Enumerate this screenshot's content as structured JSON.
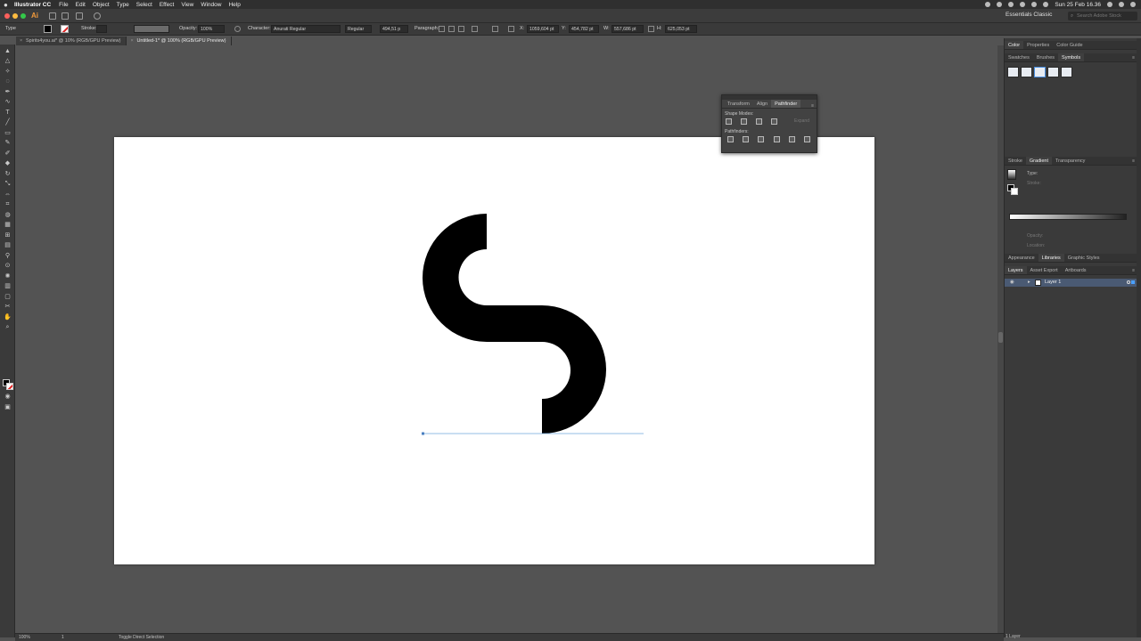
{
  "menubar": {
    "app_name": "Illustrator CC",
    "items": [
      "File",
      "Edit",
      "Object",
      "Type",
      "Select",
      "Effect",
      "View",
      "Window",
      "Help"
    ],
    "datetime": "Sun 25 Feb 16.36"
  },
  "appbar": {
    "logo": "Ai",
    "workspace": "Essentials Classic",
    "search_placeholder": "Search Adobe Stock"
  },
  "controlbar": {
    "tool_label": "Type",
    "stroke_label": "Stroke:",
    "opacity_label": "Opacity:",
    "opacity_value": "100%",
    "character_label": "Character:",
    "font_family": "Anurati Regular",
    "font_style": "Regular",
    "font_size": "494,51 p",
    "paragraph_label": "Paragraph:",
    "x_label": "X:",
    "x_value": "1059,604 pt",
    "y_label": "Y:",
    "y_value": "454,782 pt",
    "w_label": "W:",
    "w_value": "557,686 pt",
    "h_label": "H:",
    "h_value": "625,053 pt"
  },
  "doc_tabs": [
    {
      "title": "Spirits4you.ai* @ 10% (RGB/GPU Preview)",
      "active": false
    },
    {
      "title": "Untitled-1* @ 100% (RGB/GPU Preview)",
      "active": true
    }
  ],
  "pathfinder_panel": {
    "tabs": [
      "Transform",
      "Align",
      "Pathfinder"
    ],
    "active_tab": "Pathfinder",
    "shape_modes_label": "Shape Modes:",
    "expand_label": "Expand",
    "pathfinders_label": "Pathfinders:"
  },
  "dock": {
    "group1_tabs": [
      "Color",
      "Properties",
      "Color Guide"
    ],
    "group1b_tabs": [
      "Swatches",
      "Brushes",
      "Symbols"
    ],
    "group1b_active": "Symbols",
    "group2_tabs": [
      "Stroke",
      "Gradient",
      "Transparency"
    ],
    "group2_active": "Gradient",
    "gradient_type_label": "Type:",
    "gradient_stroke_label": "Stroke:",
    "gradient_opacity_label": "Opacity:",
    "gradient_location_label": "Location:",
    "group3_tabs": [
      "Appearance",
      "Libraries",
      "Graphic Styles"
    ],
    "group3_active": "Libraries",
    "group4_tabs": [
      "Layers",
      "Asset Export",
      "Artboards"
    ],
    "group4_active": "Layers",
    "layer_name": "Layer 1",
    "layer_count": "1 Layer"
  },
  "statusbar": {
    "zoom": "100%",
    "artboard_number": "1",
    "tool_status": "Toggle Direct Selection"
  },
  "colors": {
    "accent_blue": "#4a5a73",
    "artboard": "#ffffff",
    "pasteboard": "#535353",
    "glyph": "#000000"
  }
}
